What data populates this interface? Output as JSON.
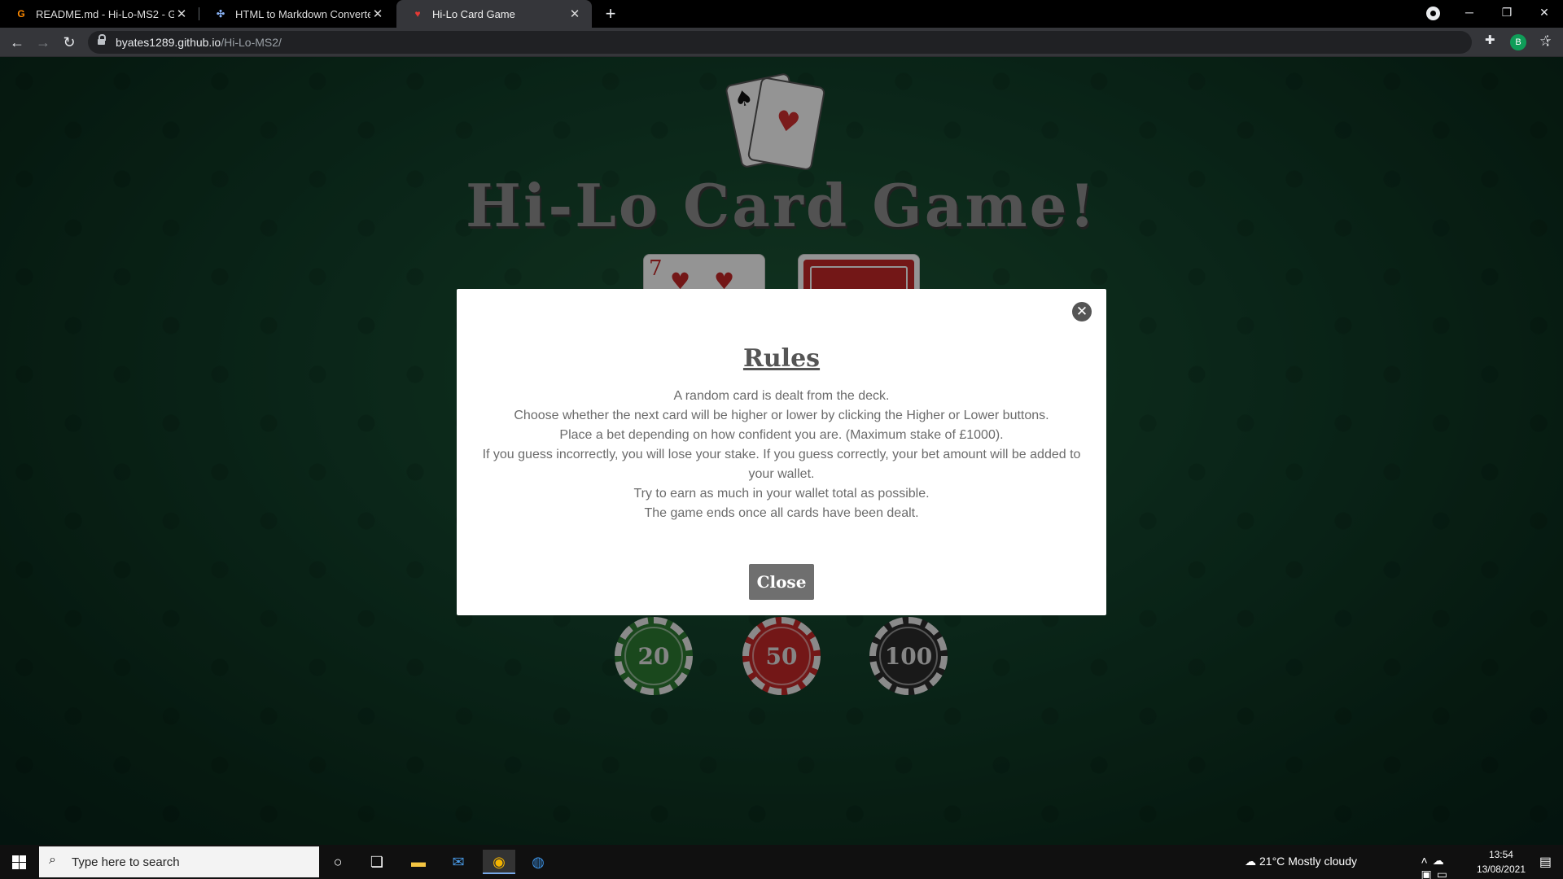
{
  "browser": {
    "tabs": [
      {
        "title": "README.md - Hi-Lo-MS2 - Gitpo",
        "favicon": "gitpod-icon"
      },
      {
        "title": "HTML to Markdown Converter - ",
        "favicon": "converter-icon"
      },
      {
        "title": "Hi-Lo Card Game",
        "favicon": "cards-icon",
        "active": true
      }
    ],
    "url_host": "byates1289.github.io",
    "url_path": "/Hi-Lo-MS2/",
    "profile_initial": "B"
  },
  "page": {
    "title": "Hi-Lo Card Game!",
    "current_card_rank": "7",
    "chips": [
      "20",
      "50",
      "100"
    ]
  },
  "modal": {
    "title": "Rules",
    "rules": [
      "A random card is dealt from the deck.",
      "Choose whether the next card will be higher or lower by clicking the Higher or Lower buttons.",
      "Place a bet depending on how confident you are. (Maximum stake of £1000).",
      "If you guess incorrectly, you will lose your stake. If you guess correctly, your bet amount will be added to your wallet.",
      "Try to earn as much in your wallet total as possible.",
      "The game ends once all cards have been dealt."
    ],
    "close_label": "Close"
  },
  "taskbar": {
    "search_placeholder": "Type here to search",
    "weather_temp": "21°C",
    "weather_desc": "Mostly cloudy",
    "time": "13:54",
    "date": "13/08/2021"
  },
  "colors": {
    "table_green": "#12402a",
    "title_grey": "#8d8d8d",
    "chip_green": "#2e7d32",
    "chip_red": "#c62828",
    "chip_black": "#2b2b2b"
  }
}
